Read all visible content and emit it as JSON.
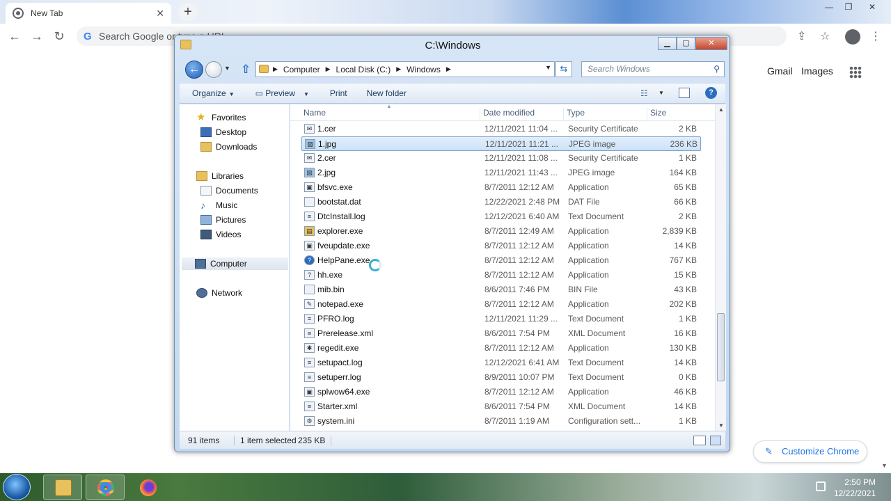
{
  "chrome": {
    "tab_title": "New Tab",
    "tab_close": "✕",
    "new_tab": "+",
    "omnibox_placeholder": "Search Google or type a URL",
    "gmail": "Gmail",
    "images": "Images",
    "customize": "Customize Chrome"
  },
  "explorer": {
    "title": "C:\\Windows",
    "breadcrumb": [
      "Computer",
      "Local Disk (C:)",
      "Windows"
    ],
    "search_placeholder": "Search Windows",
    "commands": {
      "organize": "Organize",
      "preview": "Preview",
      "print": "Print",
      "new_folder": "New folder"
    },
    "nav": {
      "favorites": "Favorites",
      "desktop": "Desktop",
      "downloads": "Downloads",
      "libraries": "Libraries",
      "documents": "Documents",
      "music": "Music",
      "pictures": "Pictures",
      "videos": "Videos",
      "computer": "Computer",
      "network": "Network"
    },
    "columns": {
      "name": "Name",
      "date": "Date modified",
      "type": "Type",
      "size": "Size"
    },
    "files": [
      {
        "name": "1.cer",
        "date": "12/11/2021 11:04 ...",
        "type": "Security Certificate",
        "size": "2 KB",
        "icon": "certificate-icon"
      },
      {
        "name": "1.jpg",
        "date": "12/11/2021 11:21 ...",
        "type": "JPEG image",
        "size": "236 KB",
        "icon": "image-icon",
        "selected": true
      },
      {
        "name": "2.cer",
        "date": "12/11/2021 11:08 ...",
        "type": "Security Certificate",
        "size": "1 KB",
        "icon": "certificate-icon"
      },
      {
        "name": "2.jpg",
        "date": "12/11/2021 11:43 ...",
        "type": "JPEG image",
        "size": "164 KB",
        "icon": "image-icon"
      },
      {
        "name": "bfsvc.exe",
        "date": "8/7/2011 12:12 AM",
        "type": "Application",
        "size": "65 KB",
        "icon": "application-icon"
      },
      {
        "name": "bootstat.dat",
        "date": "12/22/2021 2:48 PM",
        "type": "DAT File",
        "size": "66 KB",
        "icon": "file-icon"
      },
      {
        "name": "DtcInstall.log",
        "date": "12/12/2021 6:40 AM",
        "type": "Text Document",
        "size": "2 KB",
        "icon": "text-file-icon"
      },
      {
        "name": "explorer.exe",
        "date": "8/7/2011 12:49 AM",
        "type": "Application",
        "size": "2,839 KB",
        "icon": "folder-app-icon"
      },
      {
        "name": "fveupdate.exe",
        "date": "8/7/2011 12:12 AM",
        "type": "Application",
        "size": "14 KB",
        "icon": "application-icon"
      },
      {
        "name": "HelpPane.exe",
        "date": "8/7/2011 12:12 AM",
        "type": "Application",
        "size": "767 KB",
        "icon": "help-icon"
      },
      {
        "name": "hh.exe",
        "date": "8/7/2011 12:12 AM",
        "type": "Application",
        "size": "15 KB",
        "icon": "help-file-icon"
      },
      {
        "name": "mib.bin",
        "date": "8/6/2011 7:46 PM",
        "type": "BIN File",
        "size": "43 KB",
        "icon": "file-icon"
      },
      {
        "name": "notepad.exe",
        "date": "8/7/2011 12:12 AM",
        "type": "Application",
        "size": "202 KB",
        "icon": "notepad-icon"
      },
      {
        "name": "PFRO.log",
        "date": "12/11/2021 11:29 ...",
        "type": "Text Document",
        "size": "1 KB",
        "icon": "text-file-icon"
      },
      {
        "name": "Prerelease.xml",
        "date": "8/6/2011 7:54 PM",
        "type": "XML Document",
        "size": "16 KB",
        "icon": "xml-file-icon"
      },
      {
        "name": "regedit.exe",
        "date": "8/7/2011 12:12 AM",
        "type": "Application",
        "size": "130 KB",
        "icon": "registry-icon"
      },
      {
        "name": "setupact.log",
        "date": "12/12/2021 6:41 AM",
        "type": "Text Document",
        "size": "14 KB",
        "icon": "text-file-icon"
      },
      {
        "name": "setuperr.log",
        "date": "8/9/2011 10:07 PM",
        "type": "Text Document",
        "size": "0 KB",
        "icon": "text-file-icon"
      },
      {
        "name": "splwow64.exe",
        "date": "8/7/2011 12:12 AM",
        "type": "Application",
        "size": "46 KB",
        "icon": "application-icon"
      },
      {
        "name": "Starter.xml",
        "date": "8/6/2011 7:54 PM",
        "type": "XML Document",
        "size": "14 KB",
        "icon": "xml-file-icon"
      },
      {
        "name": "system.ini",
        "date": "8/7/2011 1:19 AM",
        "type": "Configuration sett...",
        "size": "1 KB",
        "icon": "settings-file-icon"
      }
    ],
    "status": {
      "count": "91 items",
      "selected": "1 item selected",
      "size": "235 KB"
    }
  },
  "taskbar": {
    "time": "2:50 PM",
    "date": "12/22/2021"
  }
}
